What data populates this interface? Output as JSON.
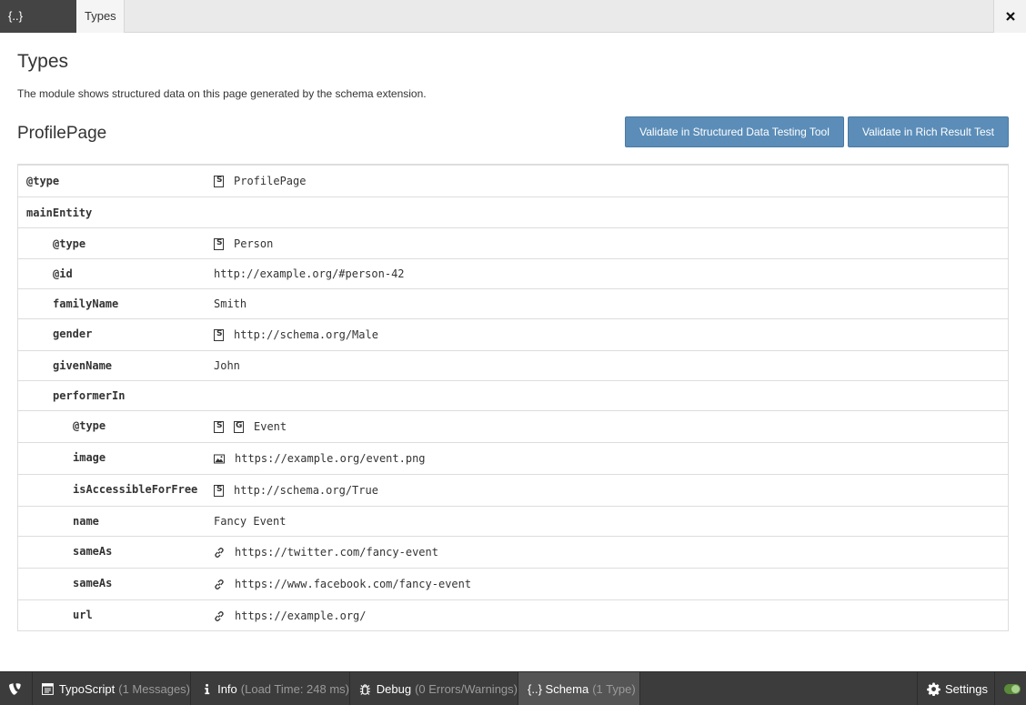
{
  "tabs": [
    {
      "label": "{..} Schema"
    },
    {
      "label": "Types"
    }
  ],
  "close_label": "×",
  "main": {
    "title": "Types",
    "intro": "The module shows structured data on this page generated by the schema extension.",
    "type_heading": "ProfilePage",
    "buttons": {
      "sdtt": "Validate in Structured Data Testing Tool",
      "rich": "Validate in Rich Result Test"
    }
  },
  "rows": [
    {
      "key": "@type",
      "value": "ProfilePage",
      "icons": [
        "schema-icon"
      ]
    },
    {
      "key": "mainEntity",
      "value": "",
      "icons": []
    },
    {
      "key": "@type",
      "value": "Person",
      "icons": [
        "schema-icon"
      ]
    },
    {
      "key": "@id",
      "value": "http://example.org/#person-42",
      "icons": []
    },
    {
      "key": "familyName",
      "value": "Smith",
      "icons": []
    },
    {
      "key": "gender",
      "value": "http://schema.org/Male",
      "icons": [
        "schema-icon"
      ]
    },
    {
      "key": "givenName",
      "value": "John",
      "icons": []
    },
    {
      "key": "performerIn",
      "value": "",
      "icons": []
    },
    {
      "key": "@type",
      "value": "Event",
      "icons": [
        "schema-icon",
        "google-icon"
      ]
    },
    {
      "key": "image",
      "value": "https://example.org/event.png",
      "icons": [
        "image-icon"
      ]
    },
    {
      "key": "isAccessibleForFree",
      "value": "http://schema.org/True",
      "icons": [
        "schema-icon"
      ]
    },
    {
      "key": "name",
      "value": "Fancy Event",
      "icons": []
    },
    {
      "key": "sameAs",
      "value": "https://twitter.com/fancy-event",
      "icons": [
        "link-icon"
      ]
    },
    {
      "key": "sameAs",
      "value": "https://www.facebook.com/fancy-event",
      "icons": [
        "link-icon"
      ]
    },
    {
      "key": "url",
      "value": "https://example.org/",
      "icons": [
        "link-icon"
      ]
    }
  ],
  "toolbar": {
    "typoscript": {
      "label": "TypoScript",
      "detail": "(1 Messages)"
    },
    "info": {
      "label": "Info",
      "detail": "(Load Time: 248 ms)"
    },
    "debug": {
      "label": "Debug",
      "detail": "(0 Errors/Warnings)"
    },
    "schema": {
      "label": "{..} Schema",
      "detail": "(1 Type)"
    },
    "settings": {
      "label": "Settings"
    }
  },
  "colors": {
    "primary_button": "#5b8db8",
    "toolbar_bg": "#3c3c3c",
    "active_tab": "#444444",
    "toggle_on": "#5a8a3a"
  }
}
